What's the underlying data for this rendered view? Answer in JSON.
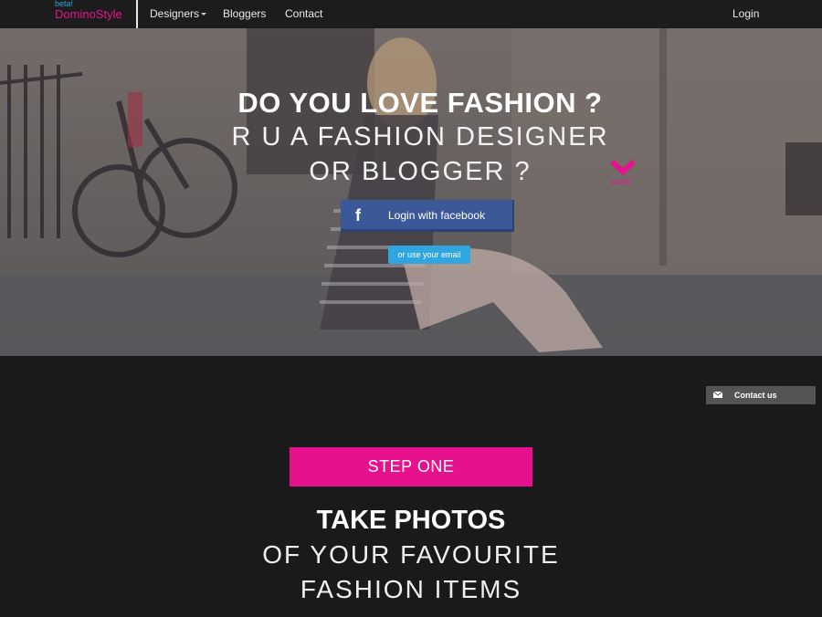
{
  "brand": {
    "beta": "beta!",
    "name": "DominoStyle"
  },
  "nav": {
    "designers": "Designers",
    "bloggers": "Bloggers",
    "contact": "Contact",
    "login": "Login"
  },
  "hero": {
    "title": "DO YOU LOVE FASHION ?",
    "subtitle_line1": "R U A FASHION DESIGNER",
    "subtitle_line2": "OR BLOGGER ?",
    "facebook_label": "Login with facebook",
    "email_label": "or use your email",
    "scroll_label": "scroll"
  },
  "contact_tab": {
    "label": "Contact us"
  },
  "step": {
    "badge": "STEP ONE",
    "title": "TAKE PHOTOS",
    "subtitle_line1": "OF YOUR FAVOURITE",
    "subtitle_line2": "FASHION ITEMS"
  },
  "colors": {
    "accent": "#e6148c",
    "facebook": "#3b5998",
    "email": "#2fa6df",
    "background": "#1b1a1b"
  }
}
